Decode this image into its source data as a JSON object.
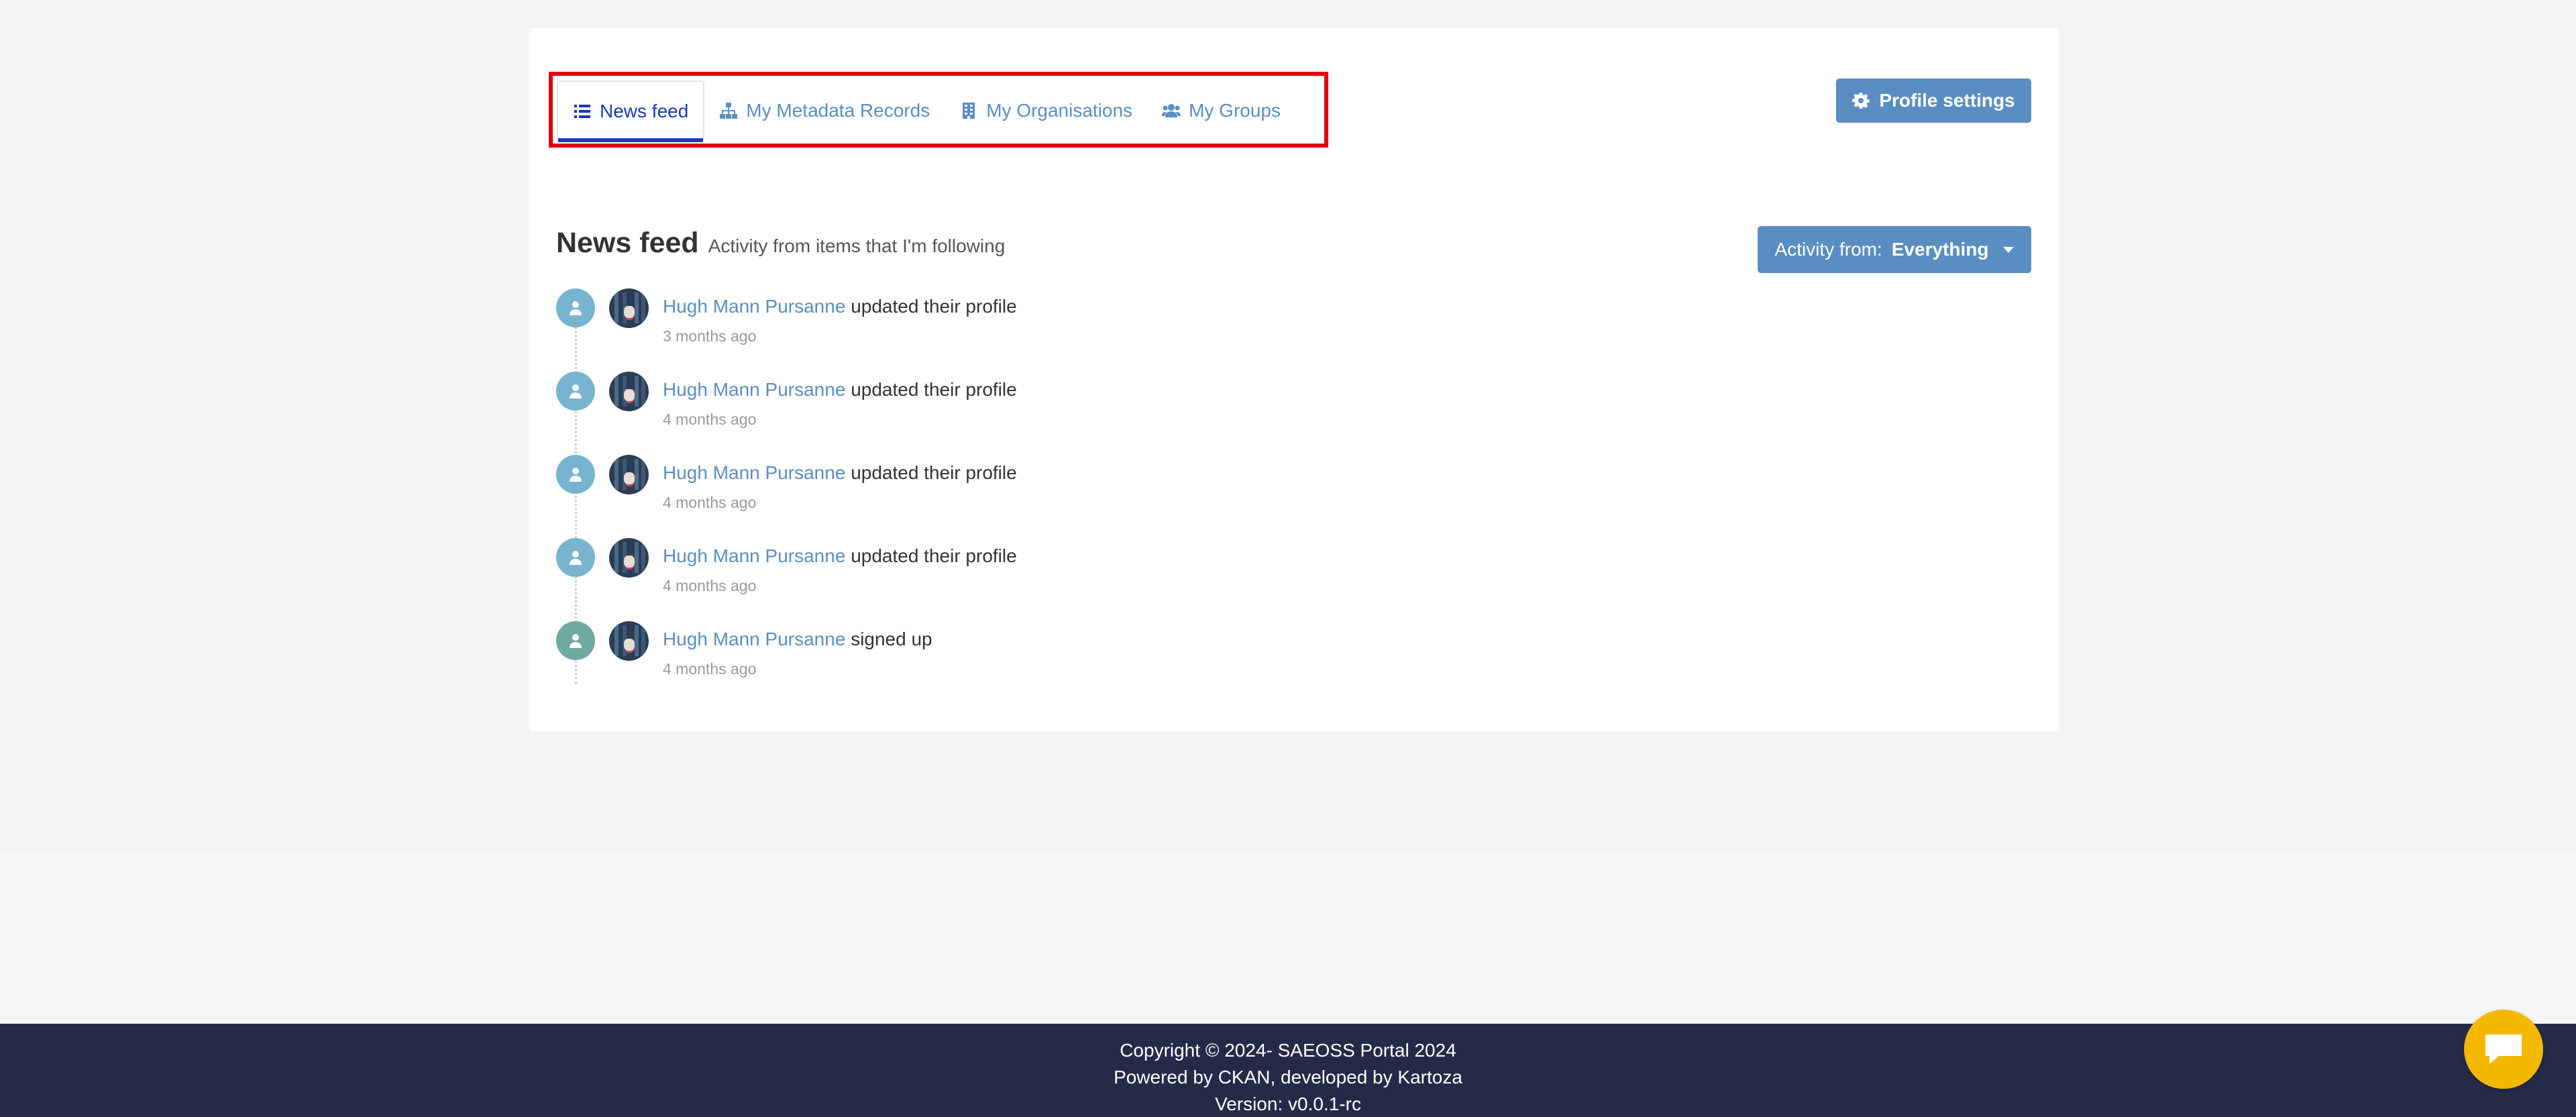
{
  "tabs": [
    {
      "label": "News feed",
      "icon": "list-icon",
      "active": true
    },
    {
      "label": "My Metadata Records",
      "icon": "sitemap-icon",
      "active": false
    },
    {
      "label": "My Organisations",
      "icon": "building-icon",
      "active": false
    },
    {
      "label": "My Groups",
      "icon": "users-icon",
      "active": false
    }
  ],
  "profile_settings_label": "Profile settings",
  "feed": {
    "title": "News feed",
    "subtitle": "Activity from items that I'm following",
    "filter_label": "Activity from:",
    "filter_value": "Everything"
  },
  "activities": [
    {
      "user": "Hugh Mann Pursanne",
      "action": "updated their profile",
      "time": "3 months ago"
    },
    {
      "user": "Hugh Mann Pursanne",
      "action": "updated their profile",
      "time": "4 months ago"
    },
    {
      "user": "Hugh Mann Pursanne",
      "action": "updated their profile",
      "time": "4 months ago"
    },
    {
      "user": "Hugh Mann Pursanne",
      "action": "updated their profile",
      "time": "4 months ago"
    },
    {
      "user": "Hugh Mann Pursanne",
      "action": "signed up",
      "time": "4 months ago"
    }
  ],
  "footer": {
    "copyright": "Copyright © 2024- SAEOSS Portal 2024",
    "powered": "Powered by CKAN, developed by Kartoza",
    "version": "Version: v0.0.1-rc"
  },
  "colors": {
    "accent": "#5a8ec2",
    "active_tab": "#1739b3",
    "highlight": "#e3000b",
    "footer_bg": "#242b48",
    "chat": "#f5b800"
  }
}
